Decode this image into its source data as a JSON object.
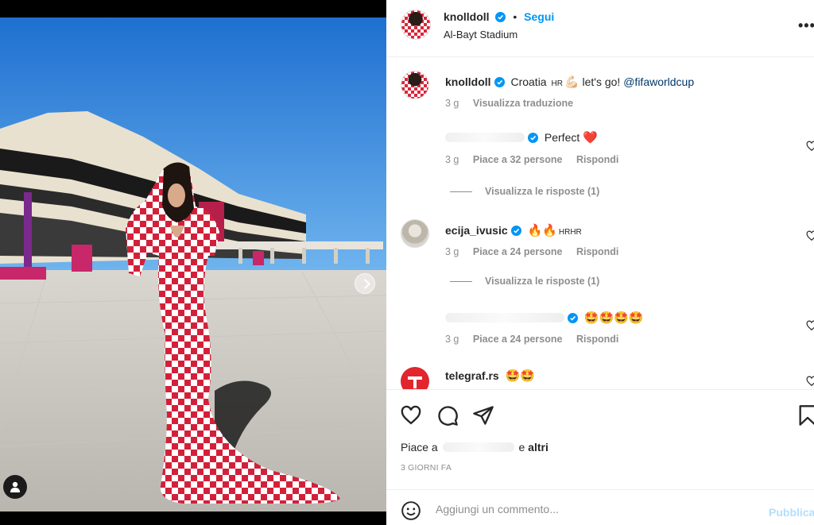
{
  "post": {
    "author": "knolldoll",
    "follow_label": "Segui",
    "location": "Al-Bayt Stadium",
    "more_label": "•••"
  },
  "caption": {
    "username": "knolldoll",
    "text_before": "Croatia",
    "flag_text": "HR",
    "emoji": "💪🏻",
    "text_after": "let's go!",
    "mention": "@fifaworldcup",
    "time": "3 g",
    "translate_label": "Visualizza traduzione"
  },
  "comments": [
    {
      "username": "",
      "text": "Perfect",
      "emoji": "❤️",
      "time": "3 g",
      "likes": "Piace a 32 persone",
      "reply_label": "Rispondi",
      "view_replies": "Visualizza le risposte (1)"
    },
    {
      "username": "ecija_ivusic",
      "text": "",
      "emoji": "🔥🔥",
      "flag_text": "HRHR",
      "time": "3 g",
      "likes": "Piace a 24 persone",
      "reply_label": "Rispondi",
      "view_replies": "Visualizza le risposte (1)"
    },
    {
      "username": "",
      "text": "",
      "emoji": "🤩🤩🤩🤩",
      "time": "3 g",
      "likes": "Piace a 24 persone",
      "reply_label": "Rispondi"
    },
    {
      "username": "telegraf.rs",
      "text": "",
      "emoji": "🤩🤩"
    }
  ],
  "likes_line": {
    "prefix": "Piace a",
    "connector": "e",
    "others": "altri"
  },
  "time_ago": "3 GIORNI FA",
  "add_comment": {
    "placeholder": "Aggiungi un commento...",
    "publish_label": "Pubblica"
  },
  "colors": {
    "accent": "#0095f6",
    "verified": "#0095f6",
    "publish_disabled": "#b2dffc",
    "secondary_text": "#8e8e8e"
  },
  "icons": {
    "like": "heart-icon",
    "comment": "comment-icon",
    "share": "paper-plane-icon",
    "save": "bookmark-icon",
    "emoji": "smiley-icon"
  }
}
